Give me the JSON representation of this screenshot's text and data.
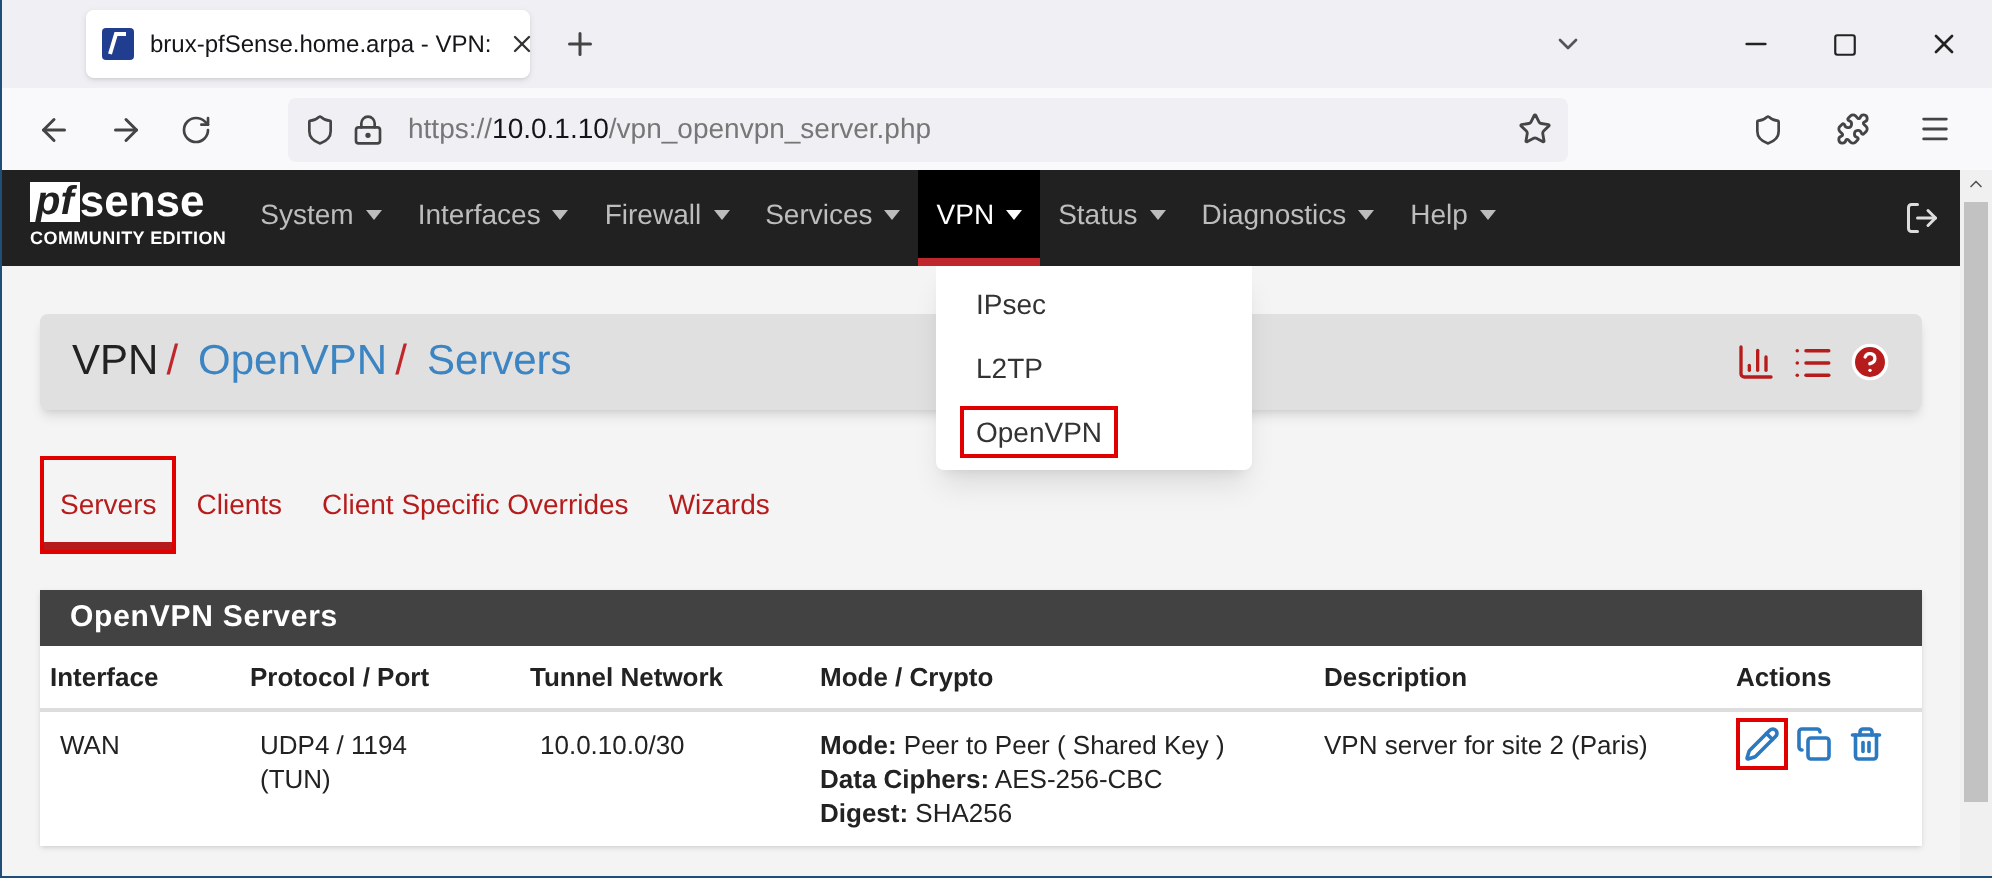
{
  "browser": {
    "tab_title": "brux-pfSense.home.arpa - VPN:",
    "url_scheme": "https://",
    "url_host": "10.0.1.10",
    "url_path": "/vpn_openvpn_server.php"
  },
  "navbar": {
    "logo": {
      "mark": "pf",
      "word": "sense",
      "edition": "COMMUNITY EDITION"
    },
    "items": [
      {
        "label": "System",
        "selected": false
      },
      {
        "label": "Interfaces",
        "selected": false
      },
      {
        "label": "Firewall",
        "selected": false
      },
      {
        "label": "Services",
        "selected": false
      },
      {
        "label": "VPN",
        "selected": true
      },
      {
        "label": "Status",
        "selected": false
      },
      {
        "label": "Diagnostics",
        "selected": false
      },
      {
        "label": "Help",
        "selected": false
      }
    ]
  },
  "dropdown": [
    {
      "label": "IPsec",
      "highlighted": false
    },
    {
      "label": "L2TP",
      "highlighted": false
    },
    {
      "label": "OpenVPN",
      "highlighted": true
    }
  ],
  "breadcrumb_separator": "/",
  "breadcrumb": [
    {
      "label": "VPN",
      "kind": "root"
    },
    {
      "label": "OpenVPN",
      "kind": "link"
    },
    {
      "label": "Servers",
      "kind": "link"
    }
  ],
  "tabs": [
    {
      "label": "Servers",
      "selected": true,
      "highlighted": true
    },
    {
      "label": "Clients",
      "selected": false,
      "highlighted": false
    },
    {
      "label": "Client Specific Overrides",
      "selected": false,
      "highlighted": false
    },
    {
      "label": "Wizards",
      "selected": false,
      "highlighted": false
    }
  ],
  "panel": {
    "title": "OpenVPN Servers",
    "columns": [
      "Interface",
      "Protocol / Port",
      "Tunnel Network",
      "Mode / Crypto",
      "Description",
      "Actions"
    ],
    "rows": [
      {
        "interface": "WAN",
        "protocol": [
          "UDP4 / 1194",
          "(TUN)"
        ],
        "tunnel": "10.0.10.0/30",
        "crypto": [
          "**Mode:** Peer to Peer ( Shared Key )",
          "**Data Ciphers:** AES-256-CBC",
          "**Digest:** SHA256"
        ],
        "description": "VPN server for site 2 (Paris)",
        "actions": [
          {
            "kind": "edit",
            "highlighted": true
          },
          {
            "kind": "copy",
            "highlighted": false
          },
          {
            "kind": "delete",
            "highlighted": false
          }
        ]
      }
    ]
  }
}
